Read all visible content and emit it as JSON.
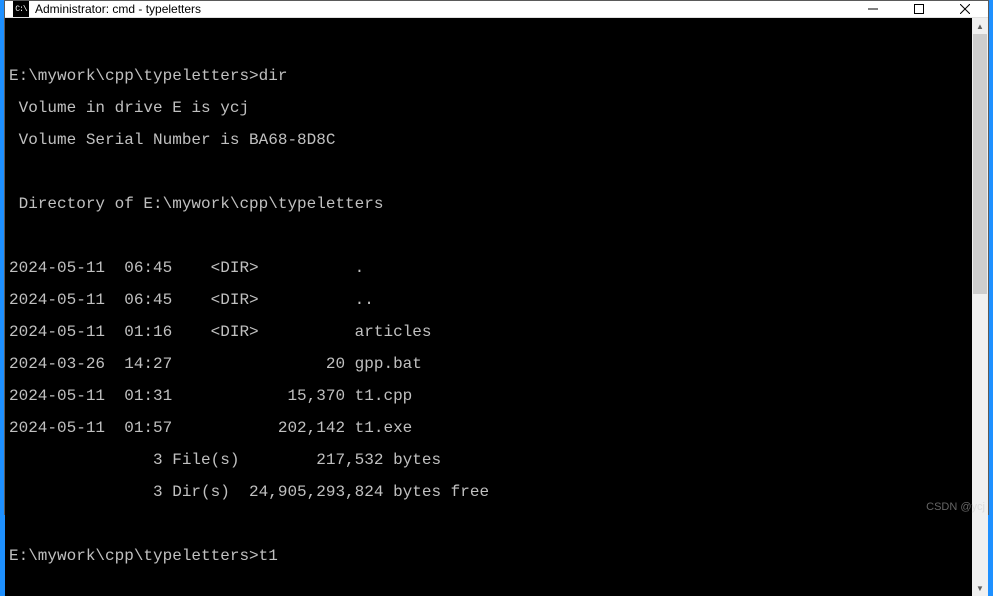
{
  "titlebar": {
    "icon_text": "C:\\",
    "title": "Administrator: cmd - typeletters"
  },
  "terminal": {
    "line1": "E:\\mywork\\cpp\\typeletters>dir",
    "line2": " Volume in drive E is ycj",
    "line3": " Volume Serial Number is BA68-8D8C",
    "line4": " Directory of E:\\mywork\\cpp\\typeletters",
    "line5": "2024-05-11  06:45    <DIR>          .",
    "line6": "2024-05-11  06:45    <DIR>          ..",
    "line7": "2024-05-11  01:16    <DIR>          articles",
    "line8": "2024-03-26  14:27                20 gpp.bat",
    "line9": "2024-05-11  01:31            15,370 t1.cpp",
    "line10": "2024-05-11  01:57           202,142 t1.exe",
    "line11": "               3 File(s)        217,532 bytes",
    "line12": "               3 Dir(s)  24,905,293,824 bytes free",
    "line13": "E:\\mywork\\cpp\\typeletters>t1"
  },
  "watermark": "CSDN @ycj"
}
